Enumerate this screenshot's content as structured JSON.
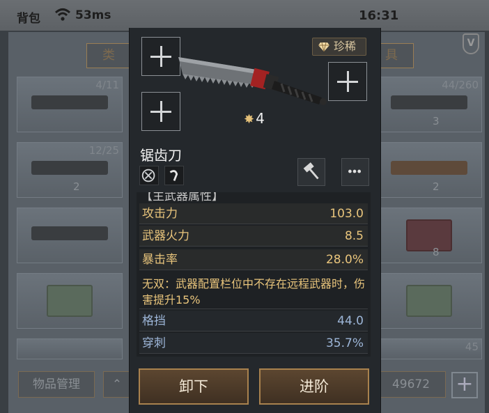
{
  "status": {
    "bag": "背包",
    "ping": "53ms",
    "time": "16:31"
  },
  "background": {
    "tab_left": "类",
    "tab_right": "具",
    "counts": [
      "4/11",
      "12/25",
      "44/260",
      "45"
    ],
    "stars": [
      "2",
      "3",
      "2",
      "8"
    ],
    "item_manage": "物品管理",
    "currency": "49672"
  },
  "item": {
    "rarity": "珍稀",
    "level": "4",
    "name": "锯齿刀",
    "section_title_cut": "【主武器属性】"
  },
  "stats": [
    {
      "key": "攻击力",
      "value": "103.0"
    },
    {
      "key": "武器火力",
      "value": "8.5"
    },
    {
      "key": "暴击率",
      "value": "28.0%"
    }
  ],
  "note": "无双：武器配置栏位中不存在远程武器时，伤害提升15%",
  "stats2": [
    {
      "key": "格挡",
      "value": "44.0"
    },
    {
      "key": "穿刺",
      "value": "35.7%"
    }
  ],
  "buttons": {
    "unequip": "卸下",
    "advance": "进阶"
  },
  "colors": {
    "gold_text": "#e9c57c",
    "blue_text": "#9db6d8",
    "button_border": "#a9824e"
  }
}
